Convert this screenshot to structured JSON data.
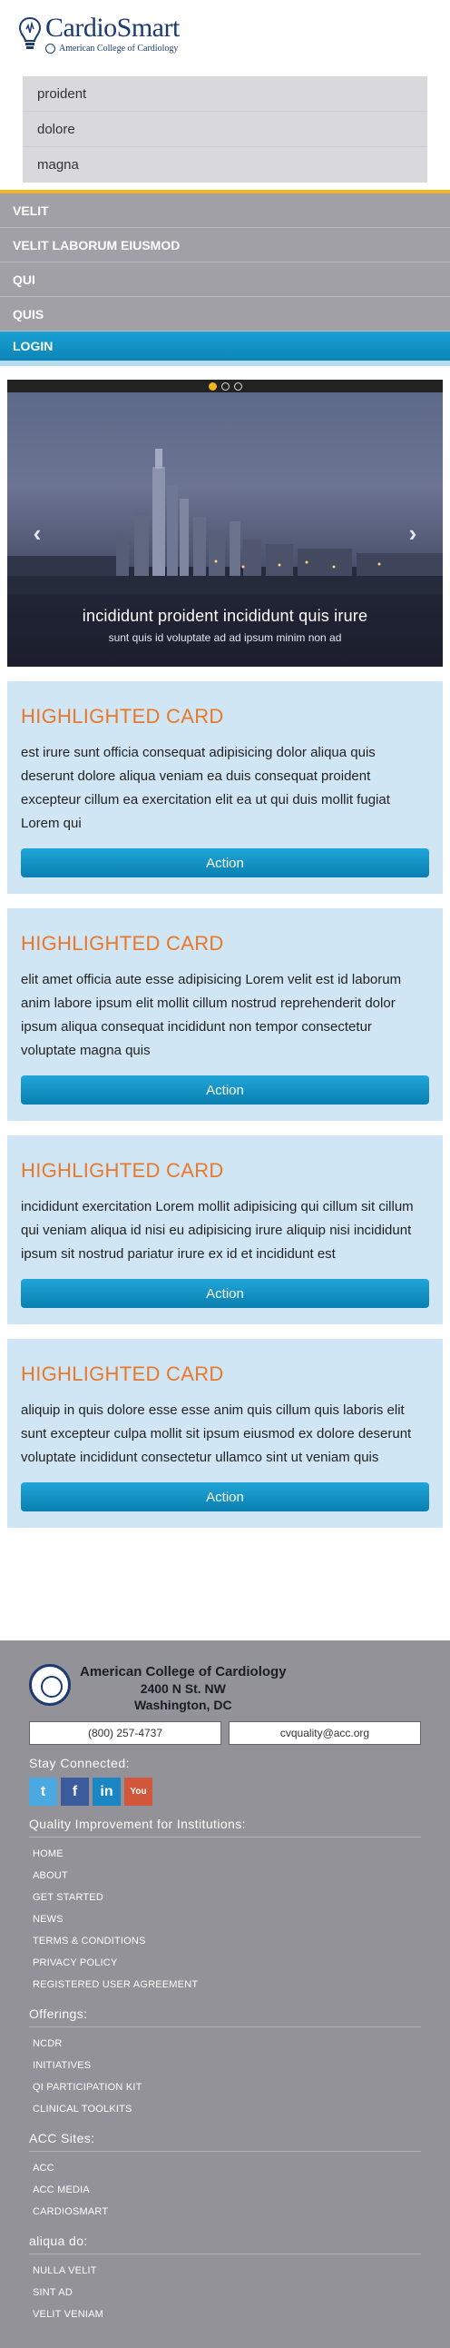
{
  "brand": {
    "name": "CardioSmart",
    "sub": "American College of Cardiology"
  },
  "dropdown": [
    "proident",
    "dolore",
    "magna"
  ],
  "nav": [
    "VELIT",
    "VELIT LABORUM EIUSMOD",
    "QUI",
    "QUIS",
    "LOGIN"
  ],
  "carousel": {
    "prev": "‹",
    "next": "›",
    "caption_title": "incididunt proident incididunt quis irure",
    "caption_sub": "sunt quis id voluptate ad ad ipsum minim non ad"
  },
  "cards": [
    {
      "title": "HIGHLIGHTED CARD",
      "text": "est irure sunt officia consequat adipisicing dolor aliqua quis deserunt dolore aliqua veniam ea duis consequat proident excepteur cillum ea exercitation elit ea ut qui duis mollit fugiat Lorem qui",
      "action": "Action"
    },
    {
      "title": "HIGHLIGHTED CARD",
      "text": "elit amet officia aute esse adipisicing Lorem velit est id laborum anim labore ipsum elit mollit cillum nostrud reprehenderit dolor ipsum aliqua consequat incididunt non tempor consectetur voluptate magna quis",
      "action": "Action"
    },
    {
      "title": "HIGHLIGHTED CARD",
      "text": "incididunt exercitation Lorem mollit adipisicing qui cillum sit cillum qui veniam aliqua id nisi eu adipisicing irure aliquip nisi incididunt ipsum sit nostrud pariatur irure ex id et incididunt est",
      "action": "Action"
    },
    {
      "title": "HIGHLIGHTED CARD",
      "text": "aliquip in quis dolore esse esse anim quis cillum quis laboris elit sunt excepteur culpa mollit sit ipsum eiusmod ex dolore deserunt voluptate incididunt consectetur ullamco sint ut veniam quis",
      "action": "Action"
    }
  ],
  "footer": {
    "org": "American College of Cardiology",
    "address1": "2400 N St. NW",
    "address2": "Washington, DC",
    "phone": "(800) 257-4737",
    "email": "cvquality@acc.org",
    "stay_connected": "Stay Connected:",
    "social": {
      "twitter": "t",
      "facebook": "f",
      "linkedin": "in",
      "youtube": "You"
    },
    "sections": [
      {
        "heading": "Quality Improvement for Institutions:",
        "links": [
          "HOME",
          "ABOUT",
          "GET STARTED",
          "NEWS",
          "TERMS & CONDITIONS",
          "PRIVACY POLICY",
          "REGISTERED USER AGREEMENT"
        ]
      },
      {
        "heading": "Offerings:",
        "links": [
          "NCDR",
          "INITIATIVES",
          "QI PARTICIPATION KIT",
          "CLINICAL TOOLKITS"
        ]
      },
      {
        "heading": "ACC Sites:",
        "links": [
          "ACC",
          "ACC MEDIA",
          "CARDIOSMART"
        ]
      },
      {
        "heading": "aliqua do:",
        "links": [
          "NULLA VELIT",
          "SINT AD",
          "VELIT VENIAM"
        ]
      }
    ]
  }
}
